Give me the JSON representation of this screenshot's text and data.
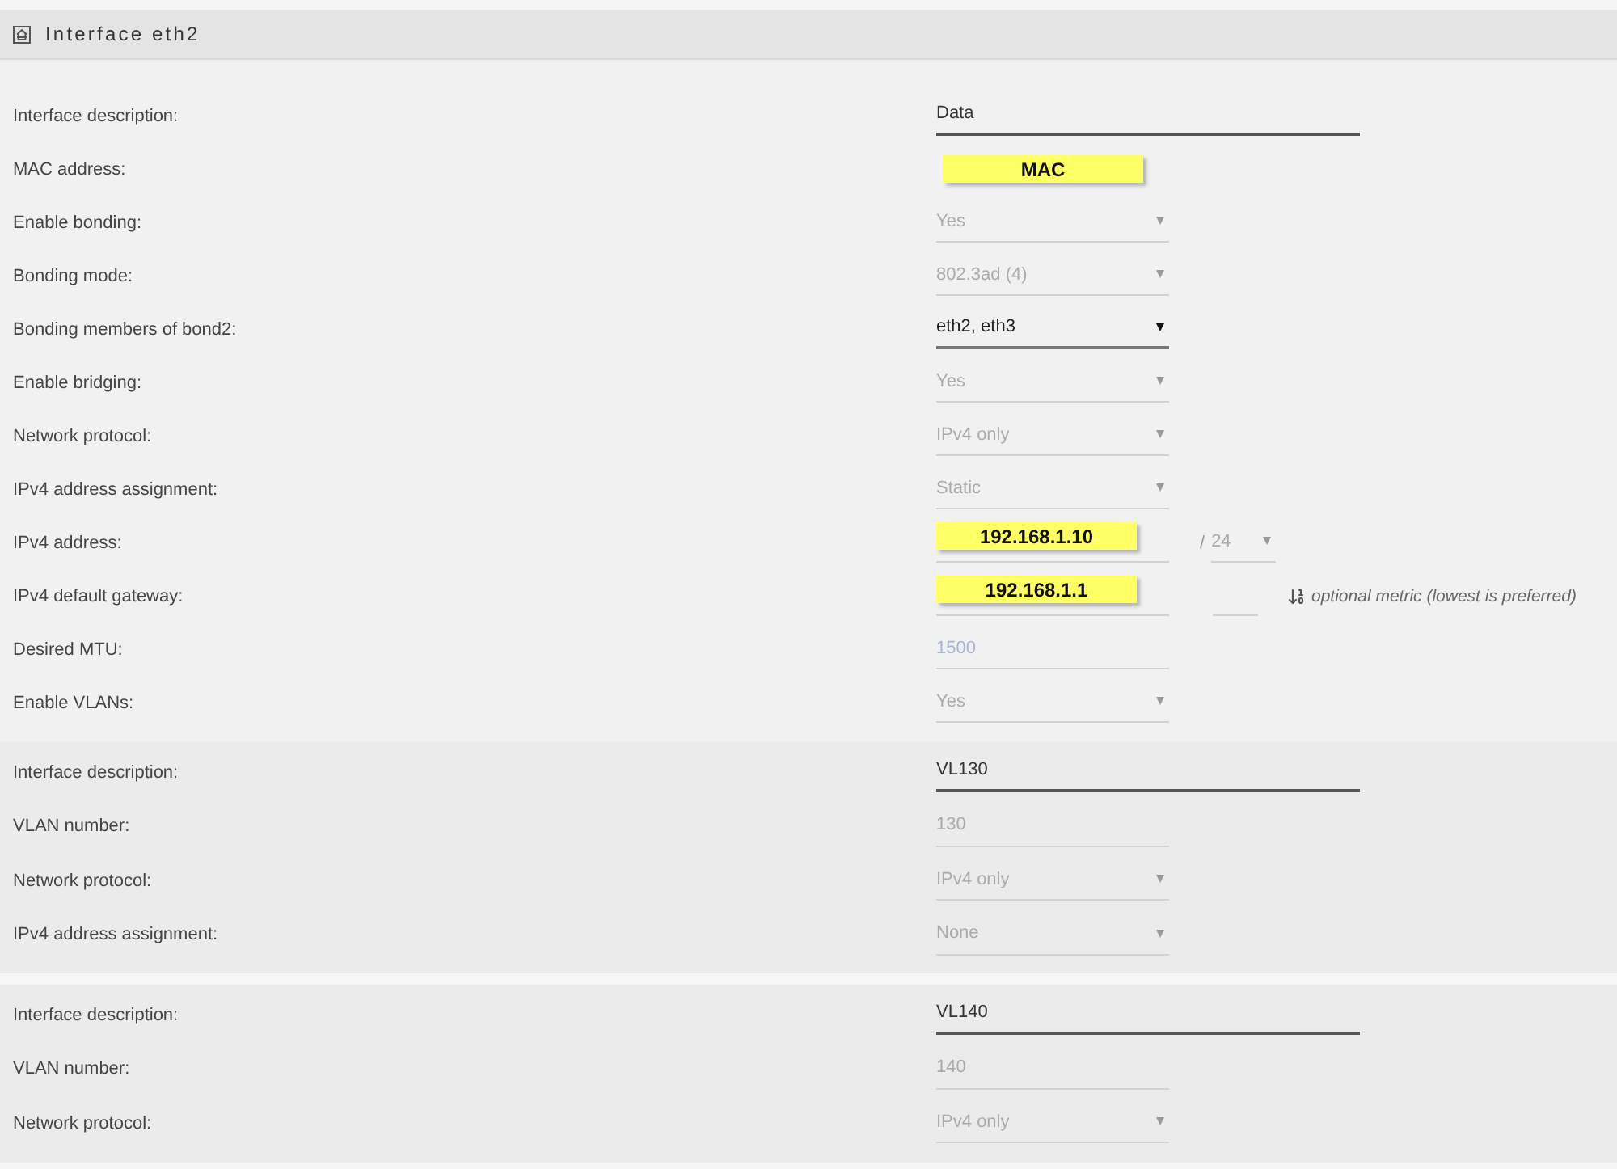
{
  "panel": {
    "title": "Interface eth2"
  },
  "sections": [
    {
      "kind": "interface",
      "rows": [
        {
          "label": "Interface description:",
          "kind": "text",
          "value": "Data",
          "disabled": false
        },
        {
          "label": "MAC address:",
          "kind": "static",
          "value": "MAC",
          "highlighted": true
        },
        {
          "label": "Enable bonding:",
          "kind": "select",
          "value": "Yes",
          "disabled": true
        },
        {
          "label": "Bonding mode:",
          "kind": "select",
          "value": "802.3ad (4)",
          "disabled": true
        },
        {
          "label": "Bonding members of bond2:",
          "kind": "select",
          "value": "eth2, eth3",
          "disabled": false
        },
        {
          "label": "Enable bridging:",
          "kind": "select",
          "value": "Yes",
          "disabled": true
        },
        {
          "label": "Network protocol:",
          "kind": "select",
          "value": "IPv4 only",
          "disabled": true
        },
        {
          "label": "IPv4 address assignment:",
          "kind": "select",
          "value": "Static",
          "disabled": true
        },
        {
          "label": "IPv4 address:",
          "kind": "field",
          "value": "192.168.1.10",
          "highlighted": true,
          "prefix": {
            "separator": "/",
            "value": "24",
            "disabled": true
          }
        },
        {
          "label": "IPv4 default gateway:",
          "kind": "field",
          "value": "192.168.1.1",
          "highlighted": true,
          "metric_field": true,
          "hint": "optional metric (lowest is preferred)"
        },
        {
          "label": "Desired MTU:",
          "kind": "field",
          "placeholder": "1500"
        },
        {
          "label": "Enable VLANs:",
          "kind": "select",
          "value": "Yes",
          "disabled": true
        }
      ]
    },
    {
      "kind": "vlan",
      "rows": [
        {
          "label": "Interface description:",
          "kind": "text",
          "value": "VL130",
          "disabled": false
        },
        {
          "label": "VLAN number:",
          "kind": "field",
          "value": "130",
          "disabled": true
        },
        {
          "label": "Network protocol:",
          "kind": "select",
          "value": "IPv4 only",
          "disabled": true
        },
        {
          "label": "IPv4 address assignment:",
          "kind": "select",
          "value": "None",
          "disabled": true
        }
      ]
    },
    {
      "kind": "vlan",
      "rows": [
        {
          "label": "Interface description:",
          "kind": "text",
          "value": "VL140",
          "disabled": false
        },
        {
          "label": "VLAN number:",
          "kind": "field",
          "value": "140",
          "disabled": true
        },
        {
          "label": "Network protocol:",
          "kind": "select",
          "value": "IPv4 only",
          "disabled": true
        }
      ]
    }
  ]
}
